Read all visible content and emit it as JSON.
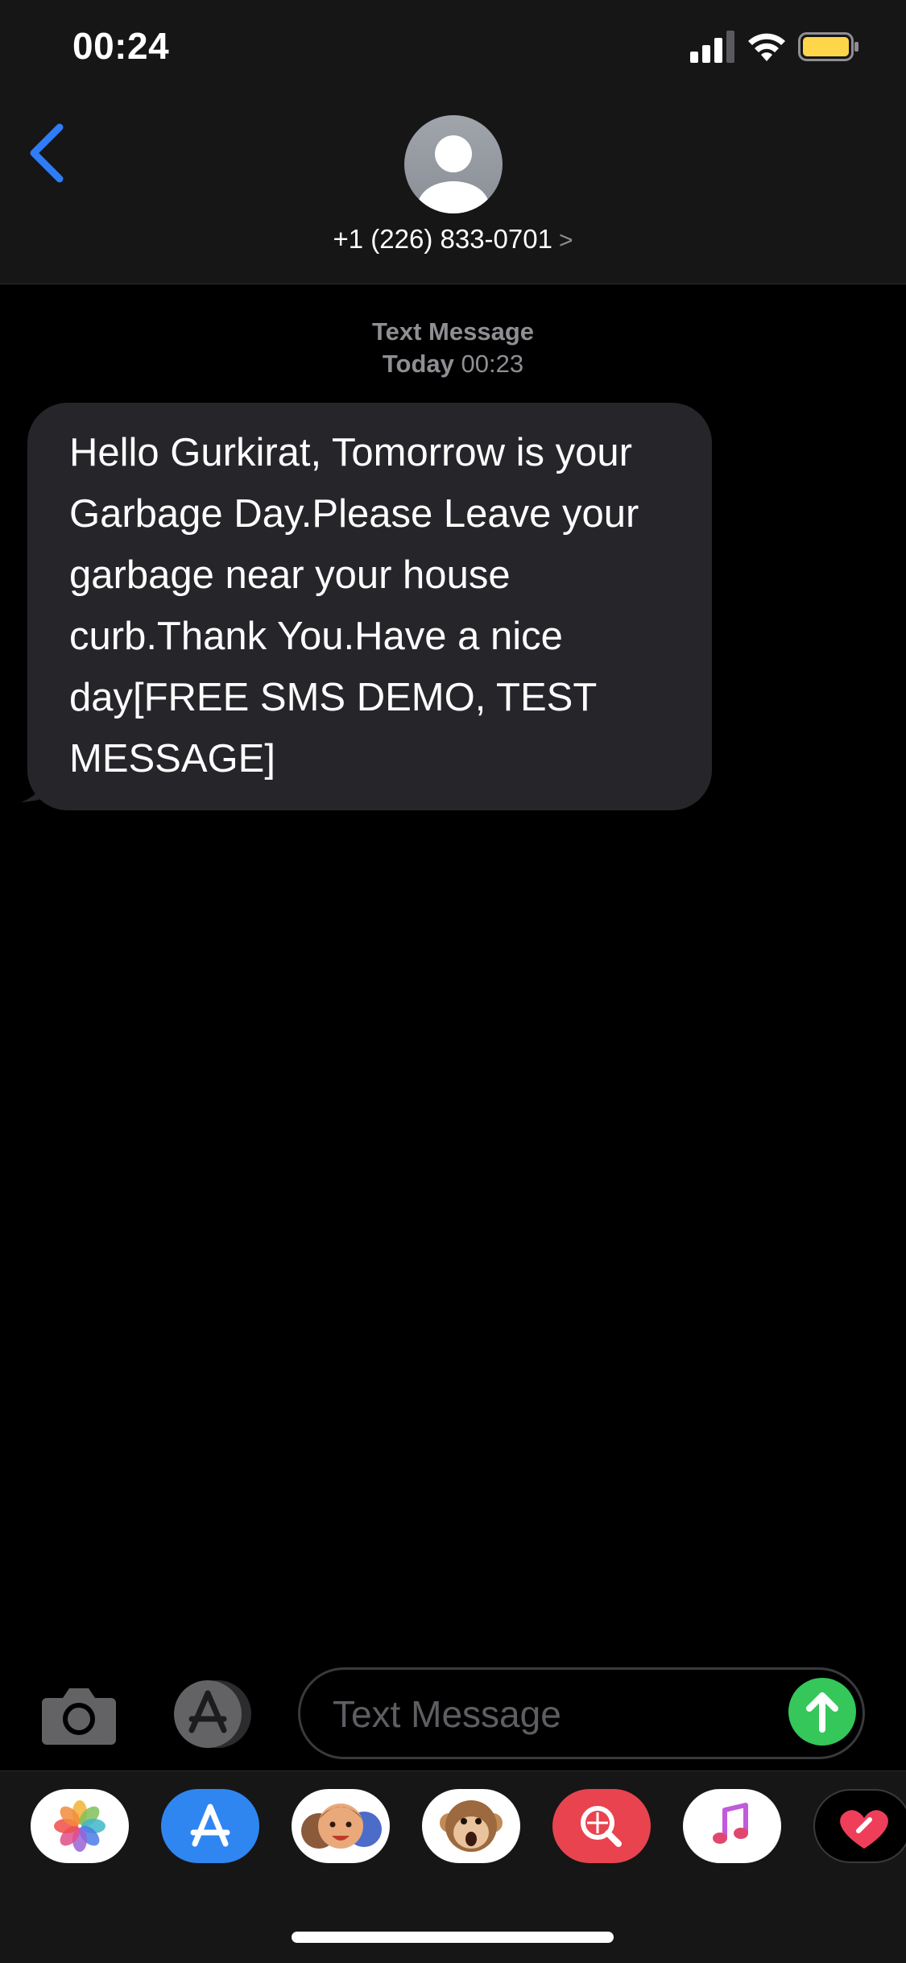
{
  "status_bar": {
    "time": "00:24",
    "icons": [
      "signal-icon",
      "wifi-icon",
      "battery-icon"
    ],
    "battery_color": "#ffd54a"
  },
  "header": {
    "contact": "+1 (226) 833-0701",
    "chevron": ">"
  },
  "thread": {
    "type_label": "Text Message",
    "day": "Today",
    "time": "00:23",
    "message": "Hello Gurkirat, Tomorrow is your Garbage Day.Please Leave your garbage near your house curb.Thank You.Have a nice day[FREE SMS DEMO, TEST MESSAGE]"
  },
  "composer": {
    "placeholder": "Text Message",
    "send_color": "#35c759"
  },
  "app_drawer": {
    "apps": [
      "photos-icon",
      "app-store-icon",
      "memoji-icon",
      "animoji-icon",
      "web-search-icon",
      "music-icon",
      "digital-touch-icon"
    ]
  },
  "colors": {
    "accent": "#2f7cf6",
    "bubble": "#26262a",
    "header": "#161616"
  }
}
